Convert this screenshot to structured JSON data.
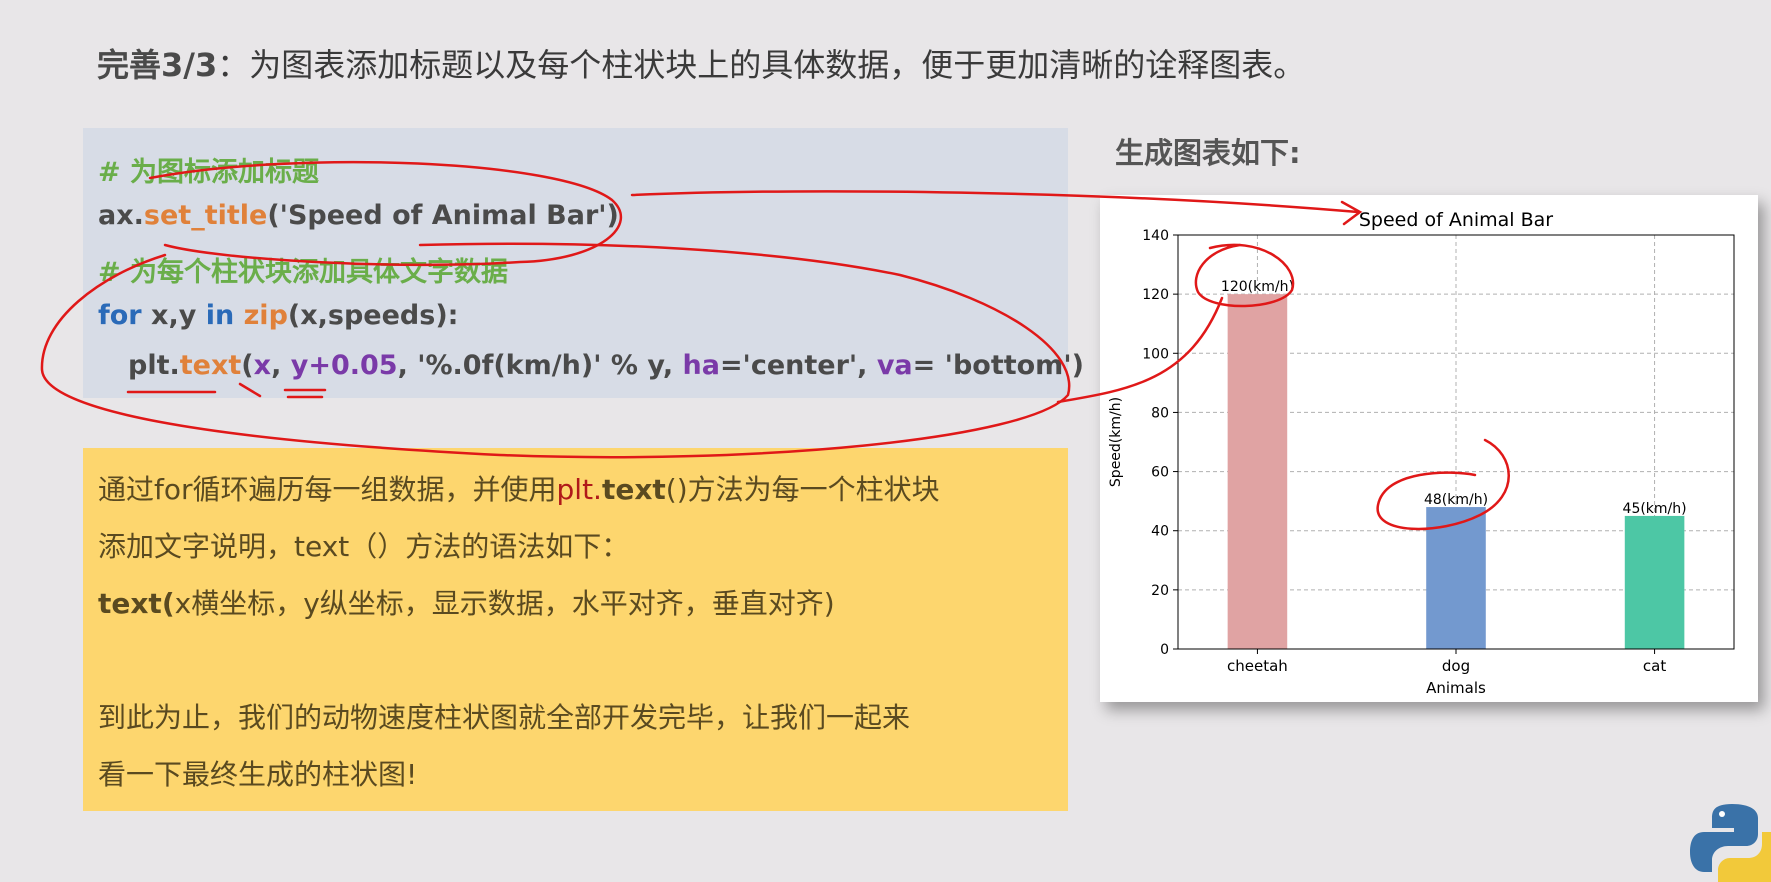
{
  "heading": {
    "prefix": "完善3/3",
    "text": "：为图表添加标题以及每个柱状块上的具体数据，便于更加清晰的诠释图表。"
  },
  "code": {
    "comment1": "# 为图标添加标题",
    "line2": {
      "obj": "ax.",
      "method": "set_title",
      "args": "('Speed of Animal Bar')"
    },
    "comment2": "# 为每个柱状块添加具体文字数据",
    "line4": {
      "kw_for": "for",
      "vars": " x,y ",
      "kw_in": "in",
      "space": " ",
      "fn": "zip",
      "args": "(x,speeds):"
    },
    "line5": {
      "obj": "plt.",
      "method": "text",
      "p1": "(",
      "x": "x",
      "comma1": ", ",
      "y": "y+0.05",
      "fmt": ", '%.0f(km/h)' % y, ",
      "ha": "ha",
      "ha_val": "='center', ",
      "va": "va",
      "va_val": "= 'bottom')"
    }
  },
  "explain": {
    "line1_pre": "通过for循环遍历每一组数据，并使用",
    "line1_plt": "plt.",
    "line1_text": "text",
    "line1_post": "()方法为每一个柱状块",
    "line2": "添加文字说明，text（）方法的语法如下：",
    "line3_bold": "text(",
    "line3_rest": "x横坐标，y纵坐标，显示数据，水平对齐，垂直对齐)",
    "line4": "到此为止，我们的动物速度柱状图就全部开发完毕，让我们一起来",
    "line5": "看一下最终生成的柱状图!"
  },
  "chart_heading": "生成图表如下:",
  "chart_data": {
    "type": "bar",
    "title": "Speed of Animal Bar",
    "xlabel": "Animals",
    "ylabel": "Speed(km/h)",
    "categories": [
      "cheetah",
      "dog",
      "cat"
    ],
    "values": [
      120,
      48,
      45
    ],
    "data_labels": [
      "120(km/h)",
      "48(km/h)",
      "45(km/h)"
    ],
    "colors": [
      "#e0a3a3",
      "#7399cf",
      "#4dc7a5"
    ],
    "ylim": [
      0,
      140
    ],
    "yticks": [
      0,
      20,
      40,
      60,
      80,
      100,
      120,
      140
    ],
    "grid": true
  },
  "colors": {
    "annotation": "#e01818"
  }
}
